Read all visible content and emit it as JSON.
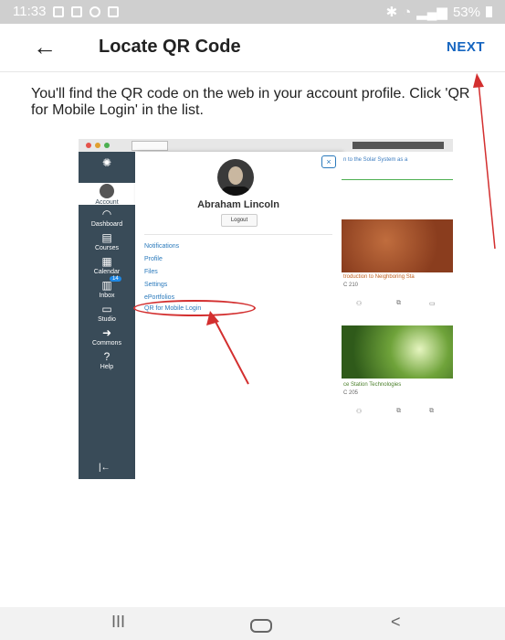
{
  "status_bar": {
    "time": "11:33",
    "battery": "53%"
  },
  "header": {
    "title": "Locate QR Code",
    "next_label": "NEXT",
    "back_glyph": "←"
  },
  "instruction": "You'll find the QR code on the web in your account profile. Click 'QR for Mobile Login' in the list.",
  "screenshot": {
    "sidebar": [
      {
        "label": "Account",
        "icon": "account-icon"
      },
      {
        "label": "Dashboard",
        "icon": "dashboard-icon"
      },
      {
        "label": "Courses",
        "icon": "courses-icon"
      },
      {
        "label": "Calendar",
        "icon": "calendar-icon"
      },
      {
        "label": "Inbox",
        "icon": "inbox-icon",
        "badge": "14"
      },
      {
        "label": "Studio",
        "icon": "studio-icon"
      },
      {
        "label": "Commons",
        "icon": "commons-icon"
      },
      {
        "label": "Help",
        "icon": "help-icon"
      }
    ],
    "tray": {
      "user_name": "Abraham Lincoln",
      "logout_label": "Logout",
      "links": [
        "Notifications",
        "Profile",
        "Files",
        "Settings",
        "ePortfolios",
        "QR for Mobile Login"
      ],
      "close_glyph": "×"
    },
    "content": {
      "header_text": "n to the Solar System as a",
      "card1_title": "troduction to Neighboring Sta",
      "card1_code": "C 210",
      "card2_title": "ce Station Technologies",
      "card2_code": "C 205"
    },
    "annotation_color": "#d32f2f"
  },
  "bottom_nav": {
    "recents_glyph": "III",
    "back_glyph": "<"
  }
}
